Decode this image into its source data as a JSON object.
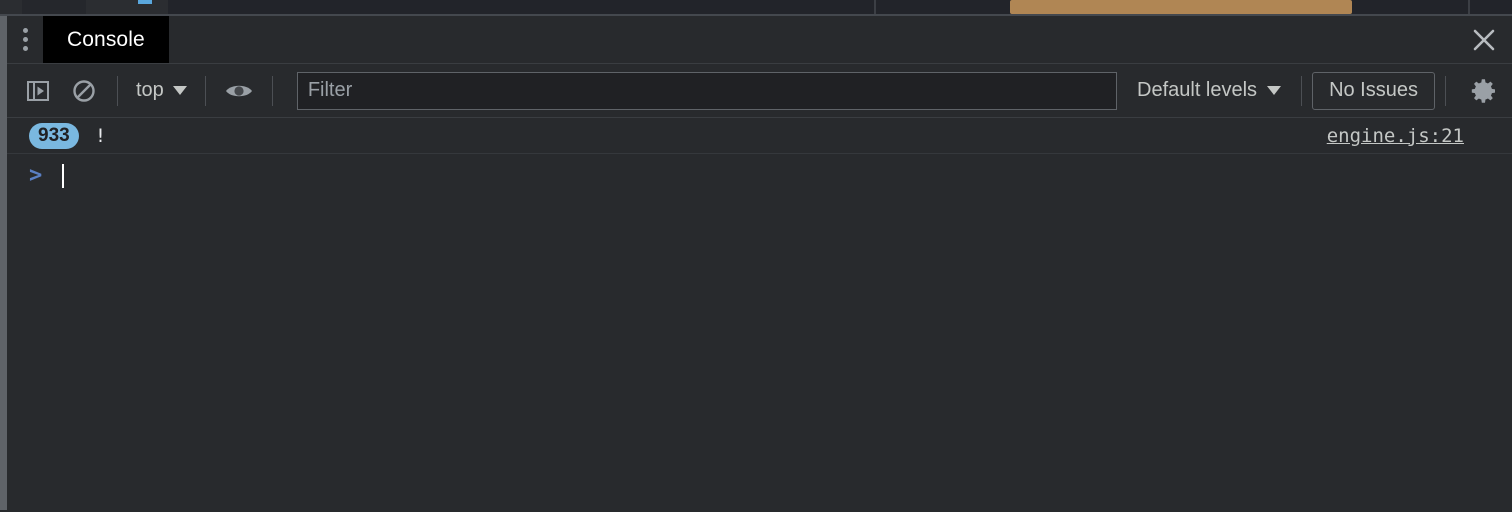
{
  "background_page": {
    "description": "partially visible page behind devtools",
    "highlight_color": "#b08654"
  },
  "devtools": {
    "tabstrip": {
      "more_tabs_label": "more-tabs",
      "tabs": [
        {
          "label": "Console",
          "selected": true
        }
      ],
      "close_label": "Close DevTools"
    },
    "toolbar": {
      "sidebar_toggle_label": "Show console sidebar",
      "clear_console_label": "Clear console",
      "context_selector": {
        "value": "top"
      },
      "live_expression_label": "Create live expression",
      "filter": {
        "value": "",
        "placeholder": "Filter"
      },
      "levels_selector": {
        "value": "Default levels"
      },
      "issues_button": {
        "label": "No Issues"
      },
      "settings_label": "Console settings"
    },
    "console": {
      "messages": [
        {
          "count": "933",
          "text": "!",
          "source": "engine.js:21"
        }
      ],
      "prompt": {
        "chevron": ">",
        "value": "",
        "placeholder": ""
      }
    }
  },
  "colors": {
    "panel_background": "#282a2d",
    "tab_selected_background": "#000000",
    "badge_background": "#7ab8e0",
    "prompt_chevron": "#5a7fc4",
    "text_primary": "#e8eaed",
    "text_secondary": "#c4c7c5",
    "border": "#5f6368"
  }
}
